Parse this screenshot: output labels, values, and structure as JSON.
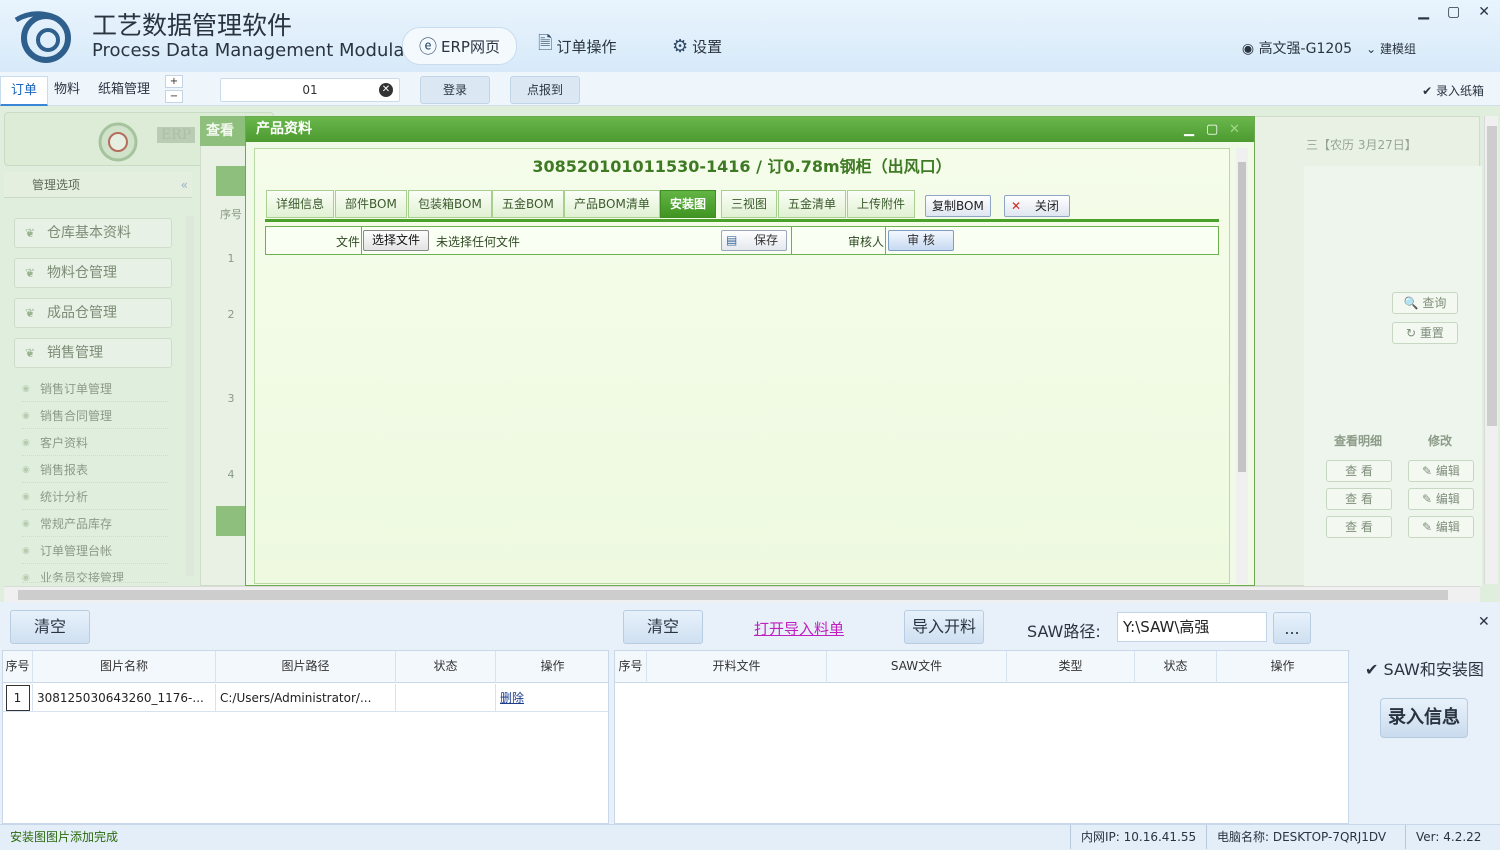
{
  "app": {
    "title_cn": "工艺数据管理软件",
    "title_en": "Process Data Management Modular"
  },
  "topnav": [
    {
      "label": "ERP网页",
      "icon": "ie-icon"
    },
    {
      "label": "订单操作",
      "icon": "document-icon"
    },
    {
      "label": "设置",
      "icon": "gear-icon"
    }
  ],
  "user": {
    "name": "高文强-G1205",
    "group": "建模组"
  },
  "tabs": [
    "订单",
    "物料",
    "纸箱管理"
  ],
  "search": {
    "value": "01"
  },
  "toolbar": {
    "login": "登录",
    "checkin": "点报到",
    "record_box": "录入纸箱"
  },
  "background": {
    "view_title": "查看",
    "side_header": "管理选项",
    "side_sections": [
      "仓库基本资料",
      "物料仓管理",
      "成品仓管理",
      "销售管理"
    ],
    "side_subitems": [
      "销售订单管理",
      "销售合同管理",
      "客户资料",
      "销售报表",
      "统计分析",
      "常规产品库存",
      "订单管理台帐",
      "业务员交接管理"
    ],
    "row_header": "序号",
    "rows": [
      "1",
      "2",
      "3",
      "4"
    ],
    "date": "三【农历 3月27日】",
    "query": "查询",
    "reset": "重置",
    "col_view": "查看明细",
    "col_edit": "修改",
    "view_btn": "查 看",
    "edit_btn": "编辑"
  },
  "modal": {
    "title": "产品资料",
    "heading": "308520101011530-1416 / 订0.78m钢柜（出风口）",
    "tabs": [
      "详细信息",
      "部件BOM",
      "包装箱BOM",
      "五金BOM",
      "产品BOM清单",
      "安装图",
      "三视图",
      "五金清单",
      "上传附件"
    ],
    "active_tab": "安装图",
    "copy_bom": "复制BOM",
    "close": "关闭",
    "file_label": "文件",
    "choose_file": "选择文件",
    "no_file": "未选择任何文件",
    "save": "保存",
    "auditor_label": "审核人",
    "audit": "审 核"
  },
  "bottom": {
    "clear_left": "清空",
    "clear_right": "清空",
    "open_import": "打开导入料单",
    "import_cut": "导入开料",
    "saw_label": "SAW路径:",
    "saw_path": "Y:\\SAW\\高强",
    "browse": "...",
    "left_headers": [
      "序号",
      "图片名称",
      "图片路径",
      "状态",
      "操作"
    ],
    "left_rows": [
      {
        "no": "1",
        "name": "308125030643260_1176-...",
        "path": "C:/Users/Administrator/...",
        "status": "",
        "action": "删除"
      }
    ],
    "right_headers": [
      "序号",
      "开料文件",
      "SAW文件",
      "类型",
      "状态",
      "操作"
    ],
    "saw_and_install": "SAW和安装图",
    "record_info": "录入信息"
  },
  "status": {
    "message": "安装图图片添加完成",
    "ip": "内网IP: 10.16.41.55",
    "computer": "电脑名称: DESKTOP-7QRJ1DV",
    "version": "Ver: 4.2.22"
  }
}
